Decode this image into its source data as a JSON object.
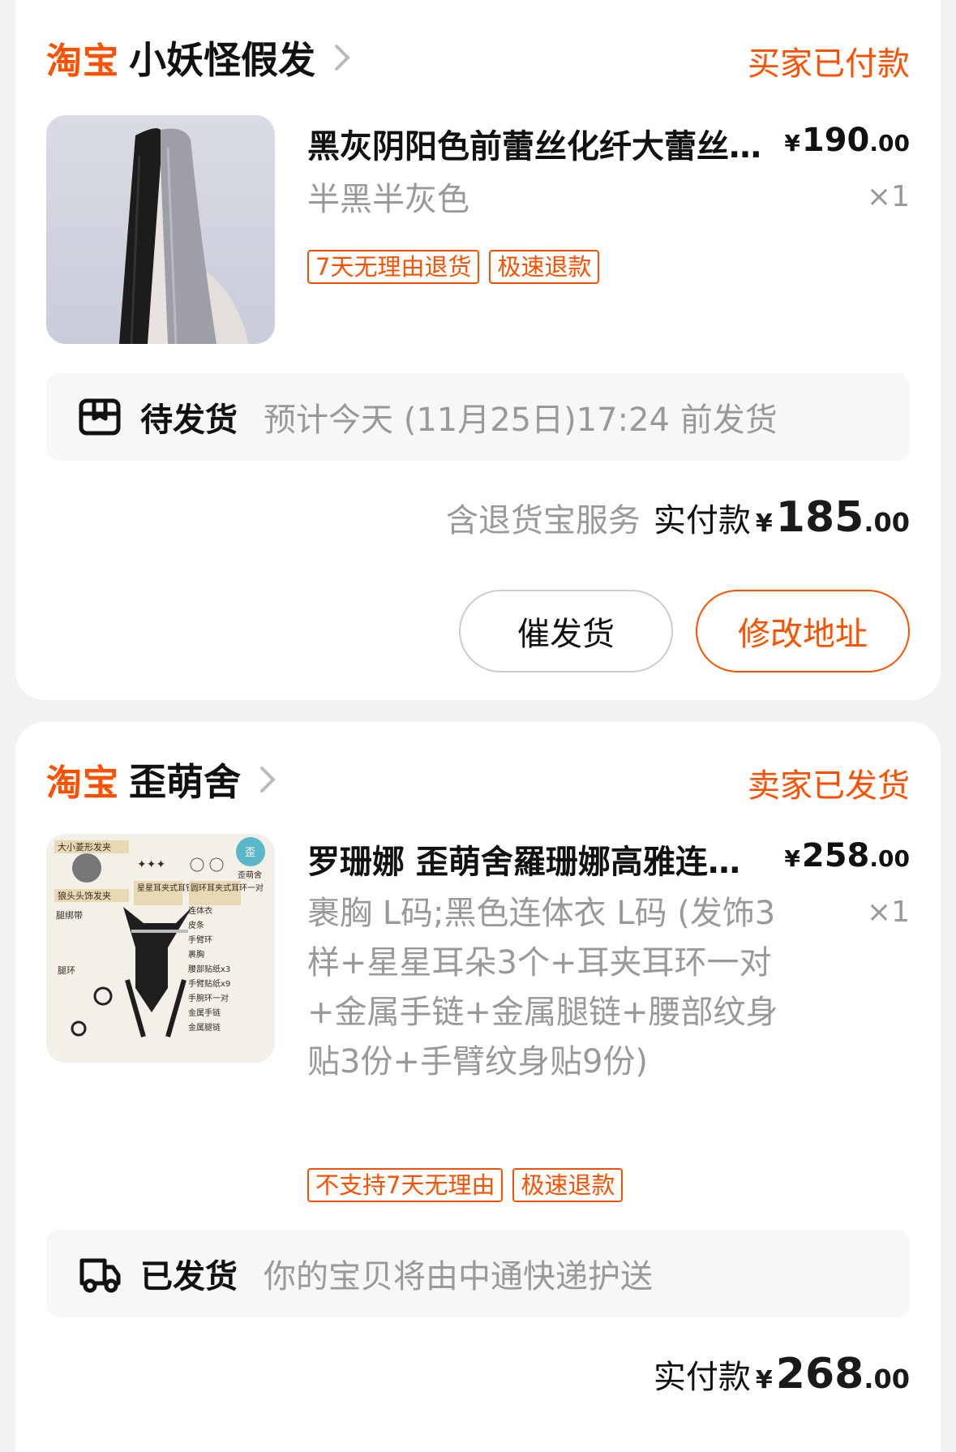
{
  "orders": [
    {
      "logo": "淘宝",
      "shop_name": "小妖怪假发",
      "status": "买家已付款",
      "item": {
        "title": "黑灰阴阳色前蕾丝化纤大蕾丝假发",
        "price_currency": "¥",
        "price_int": "190",
        "price_dec": ".00",
        "qty": "×1",
        "sku": "半黑半灰色",
        "tags": [
          "7天无理由退货",
          "极速退款"
        ]
      },
      "shipping": {
        "status": "待发货",
        "desc": "预计今天 (11月25日)17:24 前发货",
        "icon": "package-box-icon"
      },
      "summary": {
        "note": "含退货宝服务",
        "label": "实付款",
        "currency": "¥",
        "amount_int": "185",
        "amount_dec": ".00"
      },
      "buttons": {
        "urge": "催发货",
        "address": "修改地址"
      }
    },
    {
      "logo": "淘宝",
      "shop_name": "歪萌舍",
      "status": "卖家已发货",
      "item": {
        "title": "罗珊娜 歪萌舍羅珊娜高雅连体衣套装",
        "price_currency": "¥",
        "price_int": "258",
        "price_dec": ".00",
        "qty": "×1",
        "sku": "裹胸 L码;黑色连体衣 L码 (发饰3样+星星耳朵3个+耳夹耳环一对+金属手链+金属腿链+腰部纹身贴3份+手臂纹身贴9份)",
        "tags": [
          "不支持7天无理由",
          "极速退款"
        ],
        "thumb_labels": [
          "大小菱形发夹",
          "星星耳夹式耳钉x3",
          "圆环耳夹式耳环一对",
          "狼头头饰发夹",
          "腿绑带",
          "腿环",
          "连体衣",
          "皮条",
          "手臂环",
          "裹胸",
          "腰部贴纸x3",
          "手臂贴纸x9",
          "手腕环一对",
          "金属手链",
          "金属腿链",
          "歪萌舍"
        ]
      },
      "shipping": {
        "status": "已发货",
        "desc": "你的宝贝将由中通快递护送",
        "icon": "delivery-truck-icon"
      },
      "summary": {
        "label": "实付款",
        "currency": "¥",
        "amount_int": "268",
        "amount_dec": ".00"
      }
    }
  ]
}
